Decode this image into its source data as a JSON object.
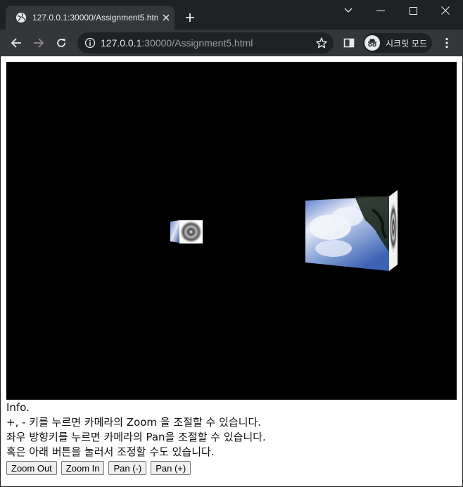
{
  "browser": {
    "tab_title": "127.0.0.1:30000/Assignment5.html",
    "url_host": "127.0.0.1",
    "url_rest": ":30000/Assignment5.html",
    "incognito_label": "시크릿 모드"
  },
  "page": {
    "info_lines": [
      "Info.",
      "+, - 키를 누르면 카메라의 Zoom 을 조절할 수 있습니다.",
      "좌우 방향키를 누르면 카메라의 Pan을 조절할 수 있습니다.",
      "혹은 아래 버튼을 눌러서 조정할 수도 있습니다."
    ],
    "buttons": {
      "zoom_out": "Zoom Out",
      "zoom_in": "Zoom In",
      "pan_minus": "Pan (-)",
      "pan_plus": "Pan (+)"
    }
  }
}
